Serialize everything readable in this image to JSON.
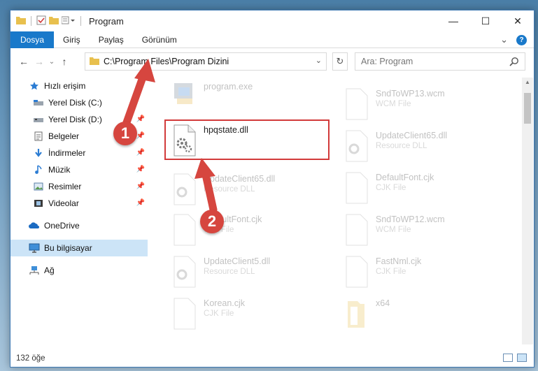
{
  "window": {
    "title": "Program",
    "controls": {
      "minimize": "—",
      "maximize": "☐",
      "close": "✕"
    }
  },
  "ribbon": {
    "tabs": [
      "Dosya",
      "Giriş",
      "Paylaş",
      "Görünüm"
    ],
    "file_tab": "Dosya",
    "expand_glyph": "⌄",
    "help_glyph": "?"
  },
  "navbar": {
    "back": "←",
    "forward": "→",
    "recent": "⌄",
    "up": "↑",
    "address": "C:\\Program Files\\Program Dizini",
    "address_dropdown": "⌄",
    "refresh": "↻",
    "search_placeholder": "Ara: Program"
  },
  "sidebar": {
    "items": [
      {
        "label": "Hızlı erişim",
        "icon": "star-icon",
        "pinned": false
      },
      {
        "label": "Yerel Disk (C:)",
        "icon": "drive-icon",
        "pinned": false
      },
      {
        "label": "Yerel Disk (D:)",
        "icon": "drive-icon",
        "pinned": true
      },
      {
        "label": "Belgeler",
        "icon": "documents-icon",
        "pinned": true
      },
      {
        "label": "İndirmeler",
        "icon": "downloads-icon",
        "pinned": true
      },
      {
        "label": "Müzik",
        "icon": "music-icon",
        "pinned": true
      },
      {
        "label": "Resimler",
        "icon": "pictures-icon",
        "pinned": true
      },
      {
        "label": "Videolar",
        "icon": "videos-icon",
        "pinned": true
      },
      {
        "label": "OneDrive",
        "icon": "onedrive-icon",
        "pinned": false
      },
      {
        "label": "Bu bilgisayar",
        "icon": "computer-icon",
        "pinned": false,
        "selected": true
      },
      {
        "label": "Ağ",
        "icon": "network-icon",
        "pinned": false
      }
    ]
  },
  "files": {
    "highlighted": {
      "name": "hpqstate.dll",
      "type": ""
    },
    "left_column": [
      {
        "name": "program.exe",
        "type": "",
        "icon": "exe-icon"
      },
      {
        "name": "UpdateClient65.dll",
        "type": "Resource DLL",
        "icon": "dll-icon"
      },
      {
        "name": "DefaultFont.cjk",
        "type": "CJK File",
        "icon": "file-icon"
      },
      {
        "name": "UpdateClient5.dll",
        "type": "Resource DLL",
        "icon": "dll-icon"
      },
      {
        "name": "Korean.cjk",
        "type": "CJK File",
        "icon": "file-icon"
      }
    ],
    "right_column": [
      {
        "name": "SndToWP13.wcm",
        "type": "WCM File",
        "icon": "file-icon"
      },
      {
        "name": "UpdateClient65.dll",
        "type": "Resource DLL",
        "icon": "dll-icon"
      },
      {
        "name": "DefaultFont.cjk",
        "type": "CJK File",
        "icon": "file-icon"
      },
      {
        "name": "SndToWP12.wcm",
        "type": "WCM File",
        "icon": "file-icon"
      },
      {
        "name": "FastNml.cjk",
        "type": "CJK File",
        "icon": "file-icon"
      },
      {
        "name": "x64",
        "type": "",
        "icon": "folder-icon"
      }
    ]
  },
  "status": {
    "count": "132 öğe"
  },
  "annotations": {
    "step1": "1",
    "step2": "2"
  },
  "colors": {
    "accent": "#1979ca",
    "annotation": "#d6463f",
    "selection": "#cce4f7"
  }
}
